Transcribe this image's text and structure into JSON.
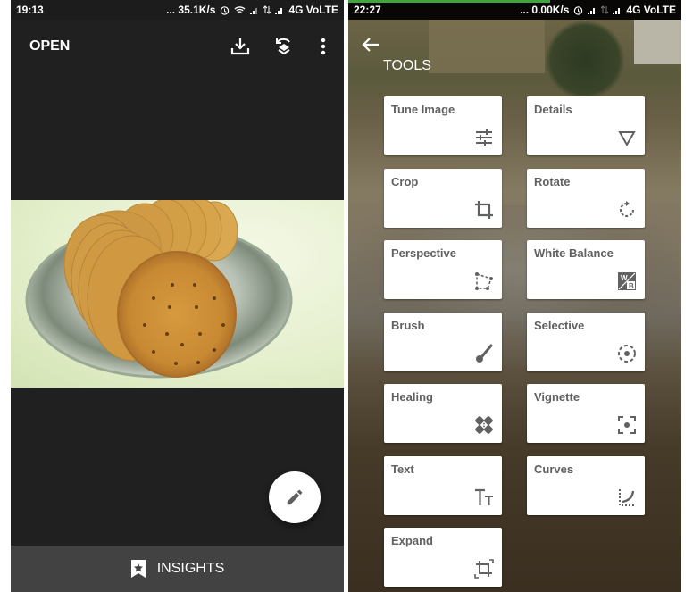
{
  "left_screen": {
    "status_bar": {
      "time": "19:13",
      "network_speed": "... 35.1K/s",
      "network_type": "4G VoLTE",
      "icons": [
        "alarm-icon",
        "wifi-icon",
        "signal-icon",
        "data-transfer-icon",
        "signal-icon"
      ]
    },
    "toolbar": {
      "open_label": "OPEN",
      "icons": [
        "download-icon",
        "layers-sync-icon",
        "more-vert-icon"
      ]
    },
    "image": {
      "description": "Biscuits on a steel plate"
    },
    "fab": {
      "icon": "pencil-icon"
    },
    "insights": {
      "label": "INSIGHTS",
      "icon": "bookmark-star-icon"
    }
  },
  "right_screen": {
    "status_bar": {
      "time": "22:27",
      "network_speed": "... 0.00K/s",
      "network_type": "4G VoLTE",
      "icons": [
        "alarm-icon",
        "signal-icon",
        "data-transfer-icon",
        "signal-icon"
      ]
    },
    "header": {
      "back_icon": "arrow-back-icon",
      "title": "TOOLS"
    },
    "tools": [
      {
        "label": "Tune Image",
        "icon": "tune-icon"
      },
      {
        "label": "Details",
        "icon": "triangle-down-icon"
      },
      {
        "label": "Crop",
        "icon": "crop-icon"
      },
      {
        "label": "Rotate",
        "icon": "rotate-icon"
      },
      {
        "label": "Perspective",
        "icon": "perspective-icon"
      },
      {
        "label": "White Balance",
        "icon": "white-balance-icon"
      },
      {
        "label": "Brush",
        "icon": "brush-icon"
      },
      {
        "label": "Selective",
        "icon": "selective-icon"
      },
      {
        "label": "Healing",
        "icon": "healing-icon"
      },
      {
        "label": "Vignette",
        "icon": "vignette-icon"
      },
      {
        "label": "Text",
        "icon": "text-icon"
      },
      {
        "label": "Curves",
        "icon": "curves-icon"
      },
      {
        "label": "Expand",
        "icon": "expand-icon"
      }
    ]
  },
  "colors": {
    "status_accent": "#3ea63a",
    "icon_gray": "#616161",
    "dark_bg": "#202020",
    "insights_bar": "#424242"
  }
}
